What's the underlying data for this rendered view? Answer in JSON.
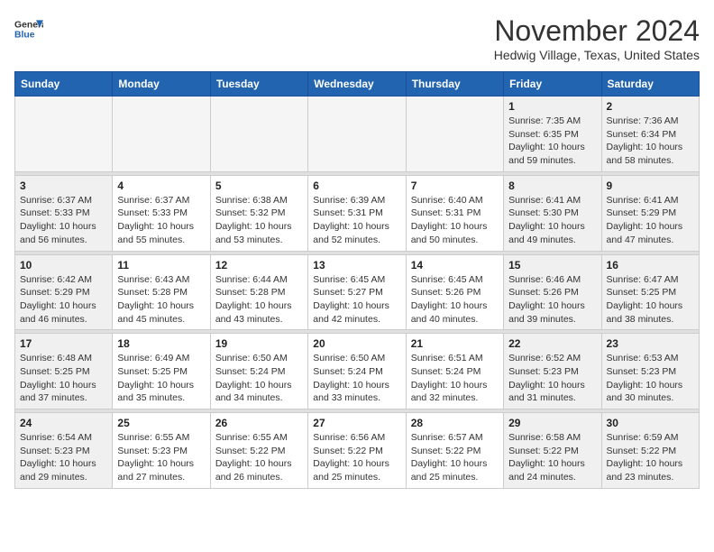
{
  "header": {
    "logo": {
      "general": "General",
      "blue": "Blue"
    },
    "title": "November 2024",
    "subtitle": "Hedwig Village, Texas, United States"
  },
  "weekdays": [
    "Sunday",
    "Monday",
    "Tuesday",
    "Wednesday",
    "Thursday",
    "Friday",
    "Saturday"
  ],
  "weeks": [
    [
      {
        "day": "",
        "empty": true
      },
      {
        "day": "",
        "empty": true
      },
      {
        "day": "",
        "empty": true
      },
      {
        "day": "",
        "empty": true
      },
      {
        "day": "",
        "empty": true
      },
      {
        "day": "1",
        "sunrise": "Sunrise: 7:35 AM",
        "sunset": "Sunset: 6:35 PM",
        "daylight": "Daylight: 10 hours and 59 minutes.",
        "weekend": true
      },
      {
        "day": "2",
        "sunrise": "Sunrise: 7:36 AM",
        "sunset": "Sunset: 6:34 PM",
        "daylight": "Daylight: 10 hours and 58 minutes.",
        "weekend": true
      }
    ],
    [
      {
        "day": "3",
        "sunrise": "Sunrise: 6:37 AM",
        "sunset": "Sunset: 5:33 PM",
        "daylight": "Daylight: 10 hours and 56 minutes.",
        "weekend": true
      },
      {
        "day": "4",
        "sunrise": "Sunrise: 6:37 AM",
        "sunset": "Sunset: 5:33 PM",
        "daylight": "Daylight: 10 hours and 55 minutes."
      },
      {
        "day": "5",
        "sunrise": "Sunrise: 6:38 AM",
        "sunset": "Sunset: 5:32 PM",
        "daylight": "Daylight: 10 hours and 53 minutes."
      },
      {
        "day": "6",
        "sunrise": "Sunrise: 6:39 AM",
        "sunset": "Sunset: 5:31 PM",
        "daylight": "Daylight: 10 hours and 52 minutes."
      },
      {
        "day": "7",
        "sunrise": "Sunrise: 6:40 AM",
        "sunset": "Sunset: 5:31 PM",
        "daylight": "Daylight: 10 hours and 50 minutes."
      },
      {
        "day": "8",
        "sunrise": "Sunrise: 6:41 AM",
        "sunset": "Sunset: 5:30 PM",
        "daylight": "Daylight: 10 hours and 49 minutes.",
        "weekend": true
      },
      {
        "day": "9",
        "sunrise": "Sunrise: 6:41 AM",
        "sunset": "Sunset: 5:29 PM",
        "daylight": "Daylight: 10 hours and 47 minutes.",
        "weekend": true
      }
    ],
    [
      {
        "day": "10",
        "sunrise": "Sunrise: 6:42 AM",
        "sunset": "Sunset: 5:29 PM",
        "daylight": "Daylight: 10 hours and 46 minutes.",
        "weekend": true
      },
      {
        "day": "11",
        "sunrise": "Sunrise: 6:43 AM",
        "sunset": "Sunset: 5:28 PM",
        "daylight": "Daylight: 10 hours and 45 minutes."
      },
      {
        "day": "12",
        "sunrise": "Sunrise: 6:44 AM",
        "sunset": "Sunset: 5:28 PM",
        "daylight": "Daylight: 10 hours and 43 minutes."
      },
      {
        "day": "13",
        "sunrise": "Sunrise: 6:45 AM",
        "sunset": "Sunset: 5:27 PM",
        "daylight": "Daylight: 10 hours and 42 minutes."
      },
      {
        "day": "14",
        "sunrise": "Sunrise: 6:45 AM",
        "sunset": "Sunset: 5:26 PM",
        "daylight": "Daylight: 10 hours and 40 minutes."
      },
      {
        "day": "15",
        "sunrise": "Sunrise: 6:46 AM",
        "sunset": "Sunset: 5:26 PM",
        "daylight": "Daylight: 10 hours and 39 minutes.",
        "weekend": true
      },
      {
        "day": "16",
        "sunrise": "Sunrise: 6:47 AM",
        "sunset": "Sunset: 5:25 PM",
        "daylight": "Daylight: 10 hours and 38 minutes.",
        "weekend": true
      }
    ],
    [
      {
        "day": "17",
        "sunrise": "Sunrise: 6:48 AM",
        "sunset": "Sunset: 5:25 PM",
        "daylight": "Daylight: 10 hours and 37 minutes.",
        "weekend": true
      },
      {
        "day": "18",
        "sunrise": "Sunrise: 6:49 AM",
        "sunset": "Sunset: 5:25 PM",
        "daylight": "Daylight: 10 hours and 35 minutes."
      },
      {
        "day": "19",
        "sunrise": "Sunrise: 6:50 AM",
        "sunset": "Sunset: 5:24 PM",
        "daylight": "Daylight: 10 hours and 34 minutes."
      },
      {
        "day": "20",
        "sunrise": "Sunrise: 6:50 AM",
        "sunset": "Sunset: 5:24 PM",
        "daylight": "Daylight: 10 hours and 33 minutes."
      },
      {
        "day": "21",
        "sunrise": "Sunrise: 6:51 AM",
        "sunset": "Sunset: 5:24 PM",
        "daylight": "Daylight: 10 hours and 32 minutes."
      },
      {
        "day": "22",
        "sunrise": "Sunrise: 6:52 AM",
        "sunset": "Sunset: 5:23 PM",
        "daylight": "Daylight: 10 hours and 31 minutes.",
        "weekend": true
      },
      {
        "day": "23",
        "sunrise": "Sunrise: 6:53 AM",
        "sunset": "Sunset: 5:23 PM",
        "daylight": "Daylight: 10 hours and 30 minutes.",
        "weekend": true
      }
    ],
    [
      {
        "day": "24",
        "sunrise": "Sunrise: 6:54 AM",
        "sunset": "Sunset: 5:23 PM",
        "daylight": "Daylight: 10 hours and 29 minutes.",
        "weekend": true
      },
      {
        "day": "25",
        "sunrise": "Sunrise: 6:55 AM",
        "sunset": "Sunset: 5:23 PM",
        "daylight": "Daylight: 10 hours and 27 minutes."
      },
      {
        "day": "26",
        "sunrise": "Sunrise: 6:55 AM",
        "sunset": "Sunset: 5:22 PM",
        "daylight": "Daylight: 10 hours and 26 minutes."
      },
      {
        "day": "27",
        "sunrise": "Sunrise: 6:56 AM",
        "sunset": "Sunset: 5:22 PM",
        "daylight": "Daylight: 10 hours and 25 minutes."
      },
      {
        "day": "28",
        "sunrise": "Sunrise: 6:57 AM",
        "sunset": "Sunset: 5:22 PM",
        "daylight": "Daylight: 10 hours and 25 minutes."
      },
      {
        "day": "29",
        "sunrise": "Sunrise: 6:58 AM",
        "sunset": "Sunset: 5:22 PM",
        "daylight": "Daylight: 10 hours and 24 minutes.",
        "weekend": true
      },
      {
        "day": "30",
        "sunrise": "Sunrise: 6:59 AM",
        "sunset": "Sunset: 5:22 PM",
        "daylight": "Daylight: 10 hours and 23 minutes.",
        "weekend": true
      }
    ]
  ]
}
